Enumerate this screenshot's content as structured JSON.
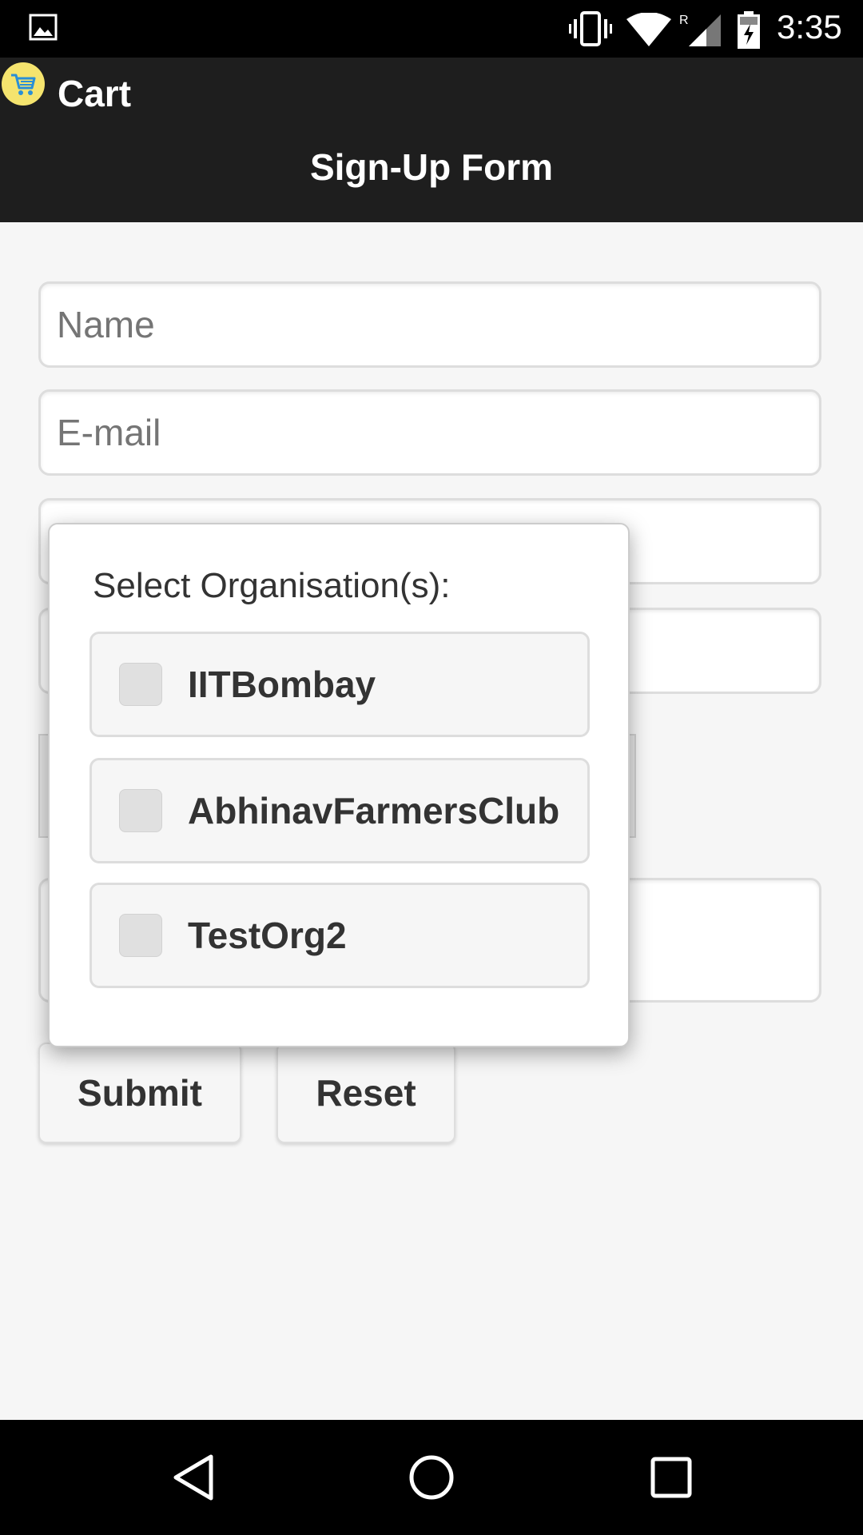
{
  "status_bar": {
    "time": "3:35",
    "icons": [
      "gallery-icon",
      "vibrate-icon",
      "wifi-icon",
      "signal-icon",
      "battery-charging-icon"
    ]
  },
  "app_bar": {
    "title": "Cart",
    "logo": "cart-icon",
    "page_header": "Sign-Up Form"
  },
  "form": {
    "name_placeholder": "Name",
    "email_placeholder": "E-mail",
    "submit_label": "Submit",
    "reset_label": "Reset"
  },
  "popup": {
    "title": "Select Organisation(s):",
    "options": [
      {
        "label": "IITBombay",
        "checked": false
      },
      {
        "label": "AbhinavFarmersClub",
        "checked": false
      },
      {
        "label": "TestOrg2",
        "checked": false
      }
    ]
  },
  "nav_bar": {
    "icons": [
      "back-icon",
      "home-icon",
      "recents-icon"
    ]
  },
  "colors": {
    "app_bar": "#1e1e1e",
    "page_background": "#f6f6f6",
    "logo_yellow": "#f5e46e",
    "cart_blue": "#2a8fd6"
  }
}
